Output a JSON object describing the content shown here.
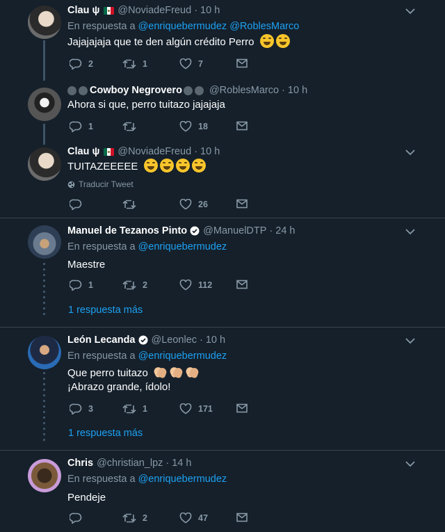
{
  "colors": {
    "background": "#15202b",
    "accent": "#1da1f2",
    "muted": "#8899a6",
    "separator": "#38444d"
  },
  "tweets": [
    {
      "name": "Clau ψ",
      "handle": "@NoviadeFreud",
      "time": "10 h",
      "reply_prefix": "En respuesta a",
      "reply_to": [
        "@enriquebermudez",
        "@RoblesMarco"
      ],
      "text": "Jajajajaja que te den algún crédito Perro",
      "replies": "2",
      "retweets": "1",
      "likes": "7"
    },
    {
      "name": "Cowboy Negrovero",
      "handle": "@RoblesMarco",
      "time": "10 h",
      "text": "Ahora si que, perro tuitazo jajajaja",
      "replies": "1",
      "retweets": "",
      "likes": "18"
    },
    {
      "name": "Clau ψ",
      "handle": "@NoviadeFreud",
      "time": "10 h",
      "text": "TUITAZEEEEE",
      "translate": "Traducir Tweet",
      "replies": "",
      "retweets": "",
      "likes": "26"
    },
    {
      "name": "Manuel de Tezanos Pinto",
      "handle": "@ManuelDTP",
      "time": "24 h",
      "reply_prefix": "En respuesta a",
      "reply_to": [
        "@enriquebermudez"
      ],
      "text": "Maestre",
      "replies": "1",
      "retweets": "2",
      "likes": "112",
      "more_replies": "1 respuesta más"
    },
    {
      "name": "León Lecanda",
      "handle": "@Leonlec",
      "time": "10 h",
      "reply_prefix": "En respuesta a",
      "reply_to": [
        "@enriquebermudez"
      ],
      "text": "Que perro tuitazo",
      "text2": "¡Abrazo grande, ídolo!",
      "replies": "3",
      "retweets": "1",
      "likes": "171",
      "more_replies": "1 respuesta más"
    },
    {
      "name": "Chris",
      "handle": "@christian_lpz",
      "time": "14 h",
      "reply_prefix": "En respuesta a",
      "reply_to": [
        "@enriquebermudez"
      ],
      "text": "Pendeje",
      "replies": "",
      "retweets": "2",
      "likes": "47"
    }
  ],
  "icons": {
    "reply": "reply-icon",
    "retweet": "retweet-icon",
    "like": "heart-icon",
    "dm": "envelope-icon",
    "menu": "chevron-down-icon",
    "verified": "verified-badge-icon",
    "globe": "globe-icon",
    "flag": "mexico-flag-icon"
  }
}
